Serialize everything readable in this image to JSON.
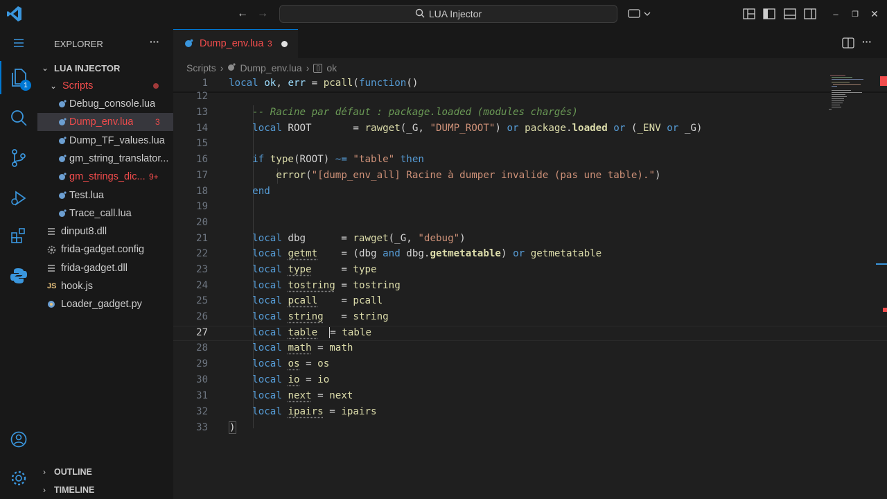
{
  "titlebar": {
    "search_text": "LUA Injector"
  },
  "explorer": {
    "title": "EXPLORER",
    "more_label": "···",
    "root_folder": "LUA INJECTOR",
    "scripts_folder": "Scripts",
    "files": [
      {
        "name": "Debug_console.lua",
        "badge": ""
      },
      {
        "name": "Dump_env.lua",
        "badge": "3"
      },
      {
        "name": "Dump_TF_values.lua",
        "badge": ""
      },
      {
        "name": "gm_string_translator...",
        "badge": ""
      },
      {
        "name": "gm_strings_dic...",
        "badge": "9+"
      },
      {
        "name": "Test.lua",
        "badge": ""
      },
      {
        "name": "Trace_call.lua",
        "badge": ""
      }
    ],
    "root_files": [
      {
        "name": "dinput8.dll",
        "icon": "file-lines-icon"
      },
      {
        "name": "frida-gadget.config",
        "icon": "gear-icon"
      },
      {
        "name": "frida-gadget.dll",
        "icon": "file-lines-icon"
      },
      {
        "name": "hook.js",
        "icon": "js-icon"
      },
      {
        "name": "Loader_gadget.py",
        "icon": "python-icon"
      }
    ],
    "outline": "OUTLINE",
    "timeline": "TIMELINE",
    "explorer_badge": "1"
  },
  "editor": {
    "tab_label": "Dump_env.lua",
    "tab_badge": "3",
    "breadcrumb": [
      "Scripts",
      "Dump_env.lua",
      "ok"
    ],
    "line_numbers": [
      "1",
      "12",
      "13",
      "14",
      "15",
      "16",
      "17",
      "18",
      "19",
      "20",
      "21",
      "22",
      "23",
      "24",
      "25",
      "26",
      "27",
      "28",
      "29",
      "30",
      "31",
      "32",
      "33"
    ]
  },
  "colors": {
    "accent": "#0078d4",
    "error_red": "#f14c4c",
    "keyword": "#569cd6",
    "string": "#ce9178",
    "function": "#dcdcaa"
  }
}
